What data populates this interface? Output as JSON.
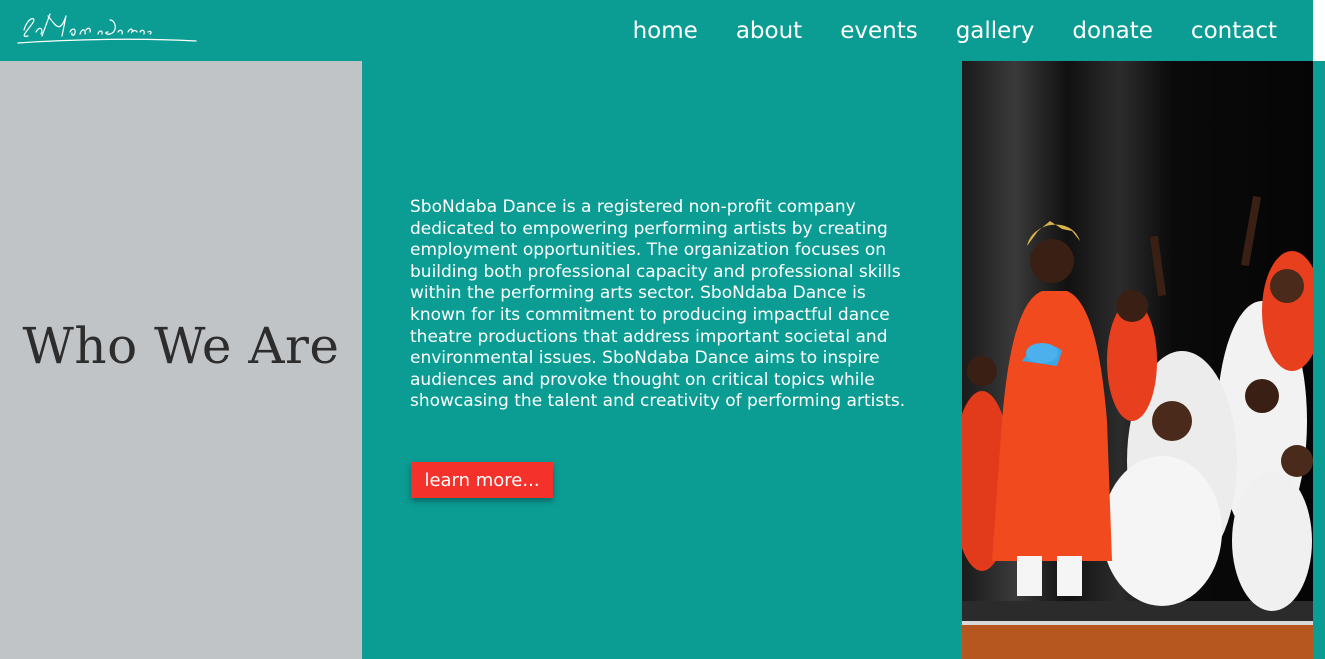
{
  "brand": {
    "logo_text": "SboNdaba Dance"
  },
  "nav": {
    "items": [
      {
        "label": "home"
      },
      {
        "label": "about"
      },
      {
        "label": "events"
      },
      {
        "label": "gallery"
      },
      {
        "label": "donate"
      },
      {
        "label": "contact"
      }
    ]
  },
  "hero": {
    "heading": "Who We Are",
    "body": "SboNdaba Dance is a registered non-profit company dedicated to empowering performing artists by creating employment opportunities. The organization focuses on building both professional capacity and professional skills within the performing arts sector. SboNdaba Dance is known for its commitment to producing impactful dance theatre productions that address important societal and environmental issues. SboNdaba Dance aims to inspire audiences and provoke thought on critical topics while showcasing the talent and creativity of performing artists.",
    "button_label": "learn more..."
  },
  "colors": {
    "teal": "#0b9d94",
    "grey_panel": "#c1c4c7",
    "button_red": "#f4312a",
    "heading_text": "#2d2d2d"
  }
}
